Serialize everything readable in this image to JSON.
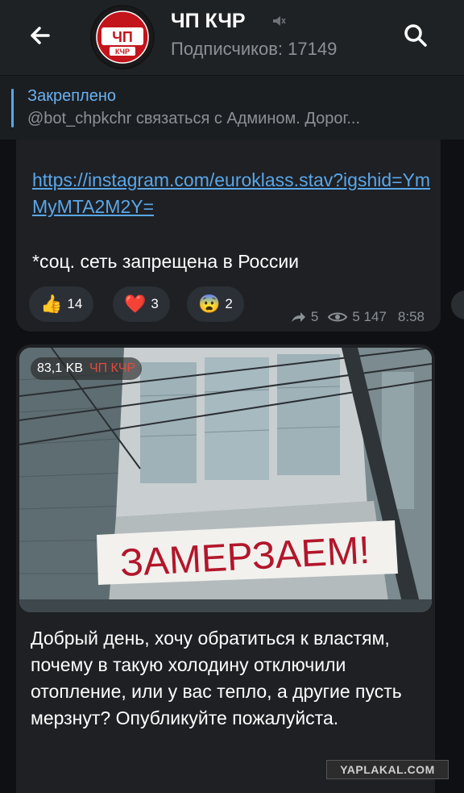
{
  "header": {
    "channel_title": "ЧП КЧР",
    "subscribers": "Подписчиков: 17149",
    "avatar_text_top": "ЧП",
    "avatar_text_bottom": "КЧР"
  },
  "pinned": {
    "title": "Закреплено",
    "text": "@bot_chpkchr связаться с Админом.  Дорог..."
  },
  "message1": {
    "link": "https://instagram.com/euroklass.stav?igshid=YmMyMTA2M2Y=",
    "text": "*соц. сеть запрещена в России",
    "reactions": [
      {
        "emoji": "👍",
        "count": "14"
      },
      {
        "emoji": "❤️",
        "count": "3"
      },
      {
        "emoji": "😨",
        "count": "2"
      }
    ],
    "forwards": "5",
    "views": "5 147",
    "time": "8:58"
  },
  "message2": {
    "file_size": "83,1 KB",
    "source": "ЧП КЧР",
    "banner_text": "ЗАМЕРЗАЕМ!",
    "text": "Добрый день, хочу обратиться к властям, почему в такую холодину отключили отопление, или у вас тепло, а другие пусть мерзнут? Опубликуйте пожалуйста."
  },
  "watermark": "YAPLAKAL.COM",
  "colors": {
    "accent": "#5aa7e8",
    "header_bg": "#1f2225",
    "bubble_bg": "#1e2024",
    "muted": "#8c9196"
  }
}
